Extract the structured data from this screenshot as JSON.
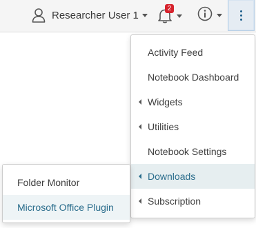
{
  "header": {
    "user_name": "Researcher User 1",
    "notification_count": "2",
    "icons": {
      "user": "user-icon",
      "notifications": "bell-icon",
      "info": "info-circle-icon",
      "more": "vertical-ellipsis-icon"
    }
  },
  "main_menu": {
    "items": [
      {
        "label": "Activity Feed",
        "has_submenu": false
      },
      {
        "label": "Notebook Dashboard",
        "has_submenu": false
      },
      {
        "label": "Widgets",
        "has_submenu": true
      },
      {
        "label": "Utilities",
        "has_submenu": true
      },
      {
        "label": "Notebook Settings",
        "has_submenu": false
      },
      {
        "label": "Downloads",
        "has_submenu": true,
        "active": true
      },
      {
        "label": "Subscription",
        "has_submenu": true
      }
    ]
  },
  "downloads_submenu": {
    "items": [
      {
        "label": "Folder Monitor"
      },
      {
        "label": "Microsoft Office Plugin",
        "hovered": true
      }
    ]
  },
  "colors": {
    "accent": "#2b6d8c",
    "badge": "#d6232d",
    "active_item_bg": "#e6eef0",
    "more_button_bg": "#e5ecf3"
  }
}
